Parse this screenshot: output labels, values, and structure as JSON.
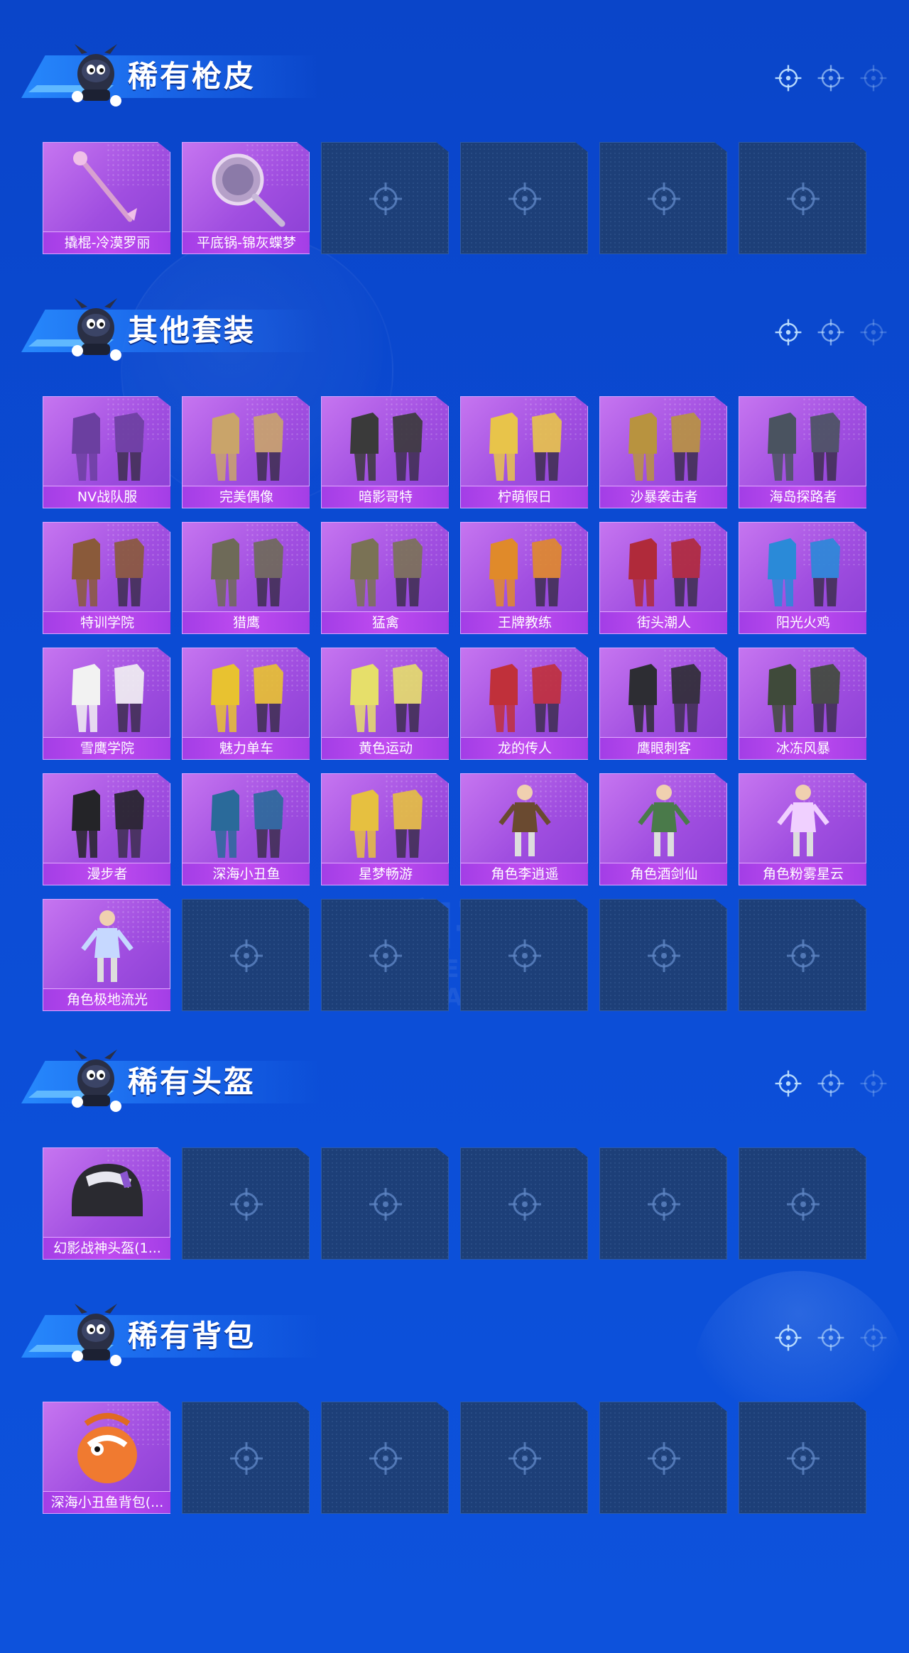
{
  "sections": [
    {
      "title": "稀有枪皮",
      "items": [
        {
          "label": "撬棍-冷漠罗丽",
          "icon": "crowbar-skin-icon"
        },
        {
          "label": "平底锅-锦灰蝶梦",
          "icon": "frying-pan-skin-icon"
        },
        null,
        null,
        null,
        null
      ]
    },
    {
      "title": "其他套装",
      "items": [
        {
          "label": "NV战队服",
          "icon": "outfit-icon"
        },
        {
          "label": "完美偶像",
          "icon": "outfit-icon"
        },
        {
          "label": "暗影哥特",
          "icon": "outfit-icon"
        },
        {
          "label": "柠萌假日",
          "icon": "outfit-icon"
        },
        {
          "label": "沙暴袭击者",
          "icon": "outfit-icon"
        },
        {
          "label": "海岛探路者",
          "icon": "outfit-icon"
        },
        {
          "label": "特训学院",
          "icon": "outfit-icon"
        },
        {
          "label": "猎鹰",
          "icon": "outfit-icon"
        },
        {
          "label": "猛禽",
          "icon": "outfit-icon"
        },
        {
          "label": "王牌教练",
          "icon": "outfit-icon"
        },
        {
          "label": "街头潮人",
          "icon": "outfit-icon"
        },
        {
          "label": "阳光火鸡",
          "icon": "outfit-icon"
        },
        {
          "label": "雪鹰学院",
          "icon": "outfit-icon"
        },
        {
          "label": "魅力单车",
          "icon": "outfit-icon"
        },
        {
          "label": "黄色运动",
          "icon": "outfit-icon"
        },
        {
          "label": "龙的传人",
          "icon": "outfit-icon"
        },
        {
          "label": "鹰眼刺客",
          "icon": "outfit-icon"
        },
        {
          "label": "冰冻风暴",
          "icon": "outfit-icon"
        },
        {
          "label": "漫步者",
          "icon": "outfit-icon"
        },
        {
          "label": "深海小丑鱼",
          "icon": "outfit-icon"
        },
        {
          "label": "星梦畅游",
          "icon": "outfit-icon"
        },
        {
          "label": "角色李逍遥",
          "icon": "character-icon"
        },
        {
          "label": "角色酒剑仙",
          "icon": "character-icon"
        },
        {
          "label": "角色粉雾星云",
          "icon": "character-icon"
        },
        {
          "label": "角色极地流光",
          "icon": "character-icon"
        },
        null,
        null,
        null,
        null,
        null
      ]
    },
    {
      "title": "稀有头盔",
      "items": [
        {
          "label": "幻影战神头盔(1...",
          "icon": "helmet-icon"
        },
        null,
        null,
        null,
        null,
        null
      ]
    },
    {
      "title": "稀有背包",
      "items": [
        {
          "label": "深海小丑鱼背包(...",
          "icon": "backpack-icon"
        },
        null,
        null,
        null,
        null,
        null
      ]
    }
  ],
  "watermark": {
    "line1": "和平",
    "line2": "GAME FOR PEACE"
  },
  "colors": {
    "background": "#0b4bd4",
    "tile_filled": "#a04ee0",
    "tile_empty": "#1d3f78",
    "label_bar": "#b346ec"
  }
}
